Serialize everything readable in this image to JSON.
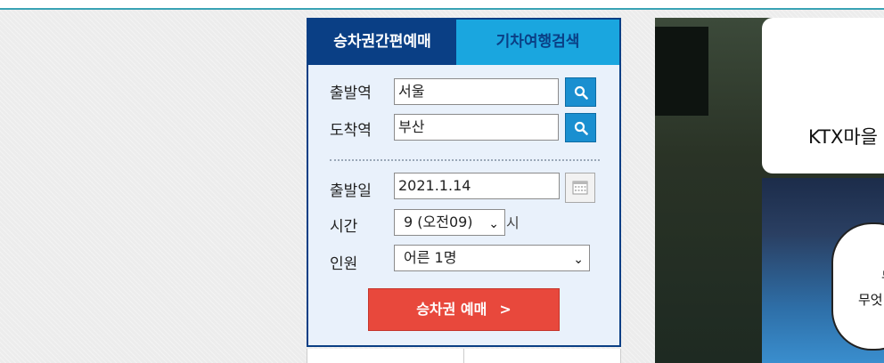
{
  "tabs": {
    "easy_booking": "승차권간편예매",
    "travel_search": "기차여행검색"
  },
  "form": {
    "departure_label": "출발역",
    "departure_value": "서울",
    "arrival_label": "도착역",
    "arrival_value": "부산",
    "date_label": "출발일",
    "date_value": "2021.1.14",
    "time_label": "시간",
    "time_value": "9 (오전09)",
    "time_suffix": "시",
    "people_label": "인원",
    "people_value": "어른 1명",
    "submit_label": "승차권 예매",
    "submit_arrow": ">"
  },
  "banner": {
    "card_text": "KTX마을",
    "bubble_line1": "누",
    "bubble_line2": "무엇"
  },
  "colors": {
    "brand_navy": "#0a3f85",
    "tab_blue": "#1aa6df",
    "cta_red": "#e8483c",
    "search_blue": "#1a8fd0"
  }
}
